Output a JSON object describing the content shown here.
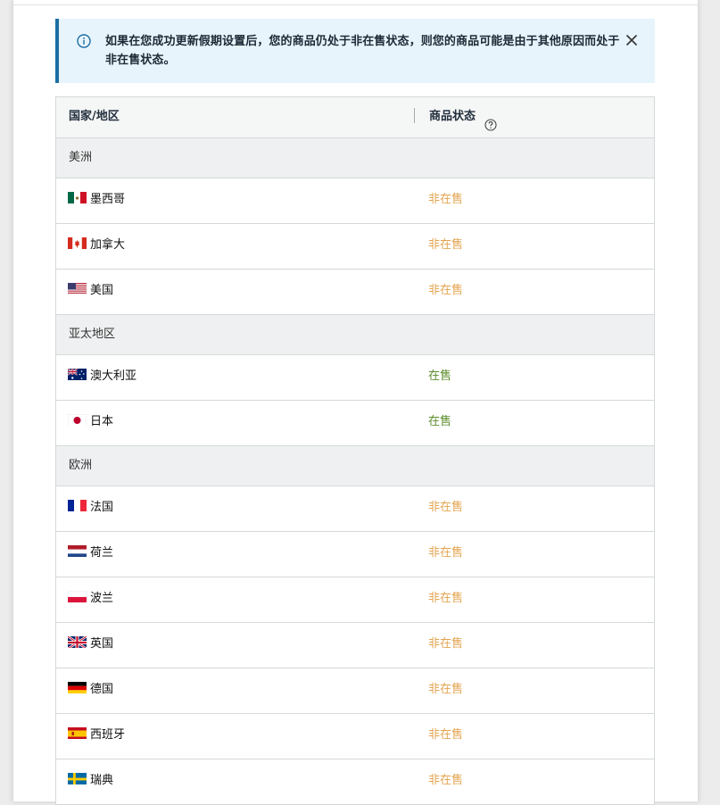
{
  "alert": {
    "icon": "info-icon",
    "message": "如果在您成功更新假期设置后，您的商品仍处于非在售状态，则您的商品可能是由于其他原因而处于非在售状态。",
    "close_icon": "close-icon"
  },
  "table": {
    "header": {
      "country": "国家/地区",
      "status": "商品状态",
      "help_icon": "help-circle-icon"
    },
    "groups": [
      {
        "name": "美洲",
        "rows": [
          {
            "flag": "mexico-flag-icon",
            "country": "墨西哥",
            "status": "非在售"
          },
          {
            "flag": "canada-flag-icon",
            "country": "加拿大",
            "status": "非在售"
          },
          {
            "flag": "usa-flag-icon",
            "country": "美国",
            "status": "非在售"
          }
        ]
      },
      {
        "name": "亚太地区",
        "rows": [
          {
            "flag": "australia-flag-icon",
            "country": "澳大利亚",
            "status": "在售"
          },
          {
            "flag": "japan-flag-icon",
            "country": "日本",
            "status": "在售"
          }
        ]
      },
      {
        "name": "欧洲",
        "rows": [
          {
            "flag": "france-flag-icon",
            "country": "法国",
            "status": "非在售"
          },
          {
            "flag": "netherlands-flag-icon",
            "country": "荷兰",
            "status": "非在售"
          },
          {
            "flag": "poland-flag-icon",
            "country": "波兰",
            "status": "非在售"
          },
          {
            "flag": "uk-flag-icon",
            "country": "英国",
            "status": "非在售"
          },
          {
            "flag": "germany-flag-icon",
            "country": "德国",
            "status": "非在售"
          },
          {
            "flag": "spain-flag-icon",
            "country": "西班牙",
            "status": "非在售"
          },
          {
            "flag": "sweden-flag-icon",
            "country": "瑞典",
            "status": "非在售"
          }
        ]
      }
    ]
  },
  "colors": {
    "inactive_status": "#e3a44f",
    "active_status": "#5b8c2a",
    "alert_background": "#e8f4fc",
    "alert_accent": "#1c6ea4"
  }
}
